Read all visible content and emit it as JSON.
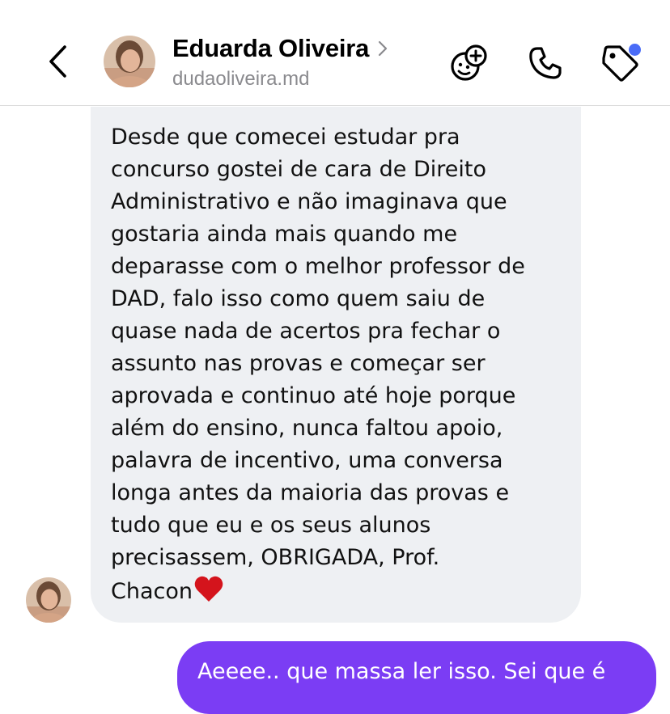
{
  "header": {
    "back_icon": "chevron-left-icon",
    "contact_name": "Eduarda Oliveira",
    "name_chevron_icon": "chevron-right-icon",
    "username": "dudaoliveira.md",
    "actions": [
      {
        "name": "effects-button",
        "icon": "emoji-plus-icon"
      },
      {
        "name": "call-button",
        "icon": "phone-icon"
      },
      {
        "name": "tag-button",
        "icon": "tag-icon"
      }
    ],
    "notification_dot_color": "#4a6cf7"
  },
  "messages": [
    {
      "direction": "incoming",
      "text": "Desde que comecei estudar pra\nconcurso gostei de cara de Direito\nAdministrativo e não imaginava que\ngostaria ainda mais quando me\ndeparasse com o melhor professor de\nDAD, falo isso como quem saiu de\nquase nada de acertos pra fechar o\nassunto nas provas e começar ser\naprovada e continuo até hoje porque\nalém do ensino, nunca faltou apoio,\npalavra de incentivo, uma conversa\nlonga antes da maioria das provas e\ntudo que eu e os seus alunos\nprecisassem, OBRIGADA, Prof.\nChacon",
      "emoji": "red-heart-icon",
      "bubble_color": "#eef0f3"
    },
    {
      "direction": "outgoing",
      "text": "Aeeee.. que massa ler isso. Sei que é",
      "bubble_color": "#7b3df4"
    }
  ]
}
